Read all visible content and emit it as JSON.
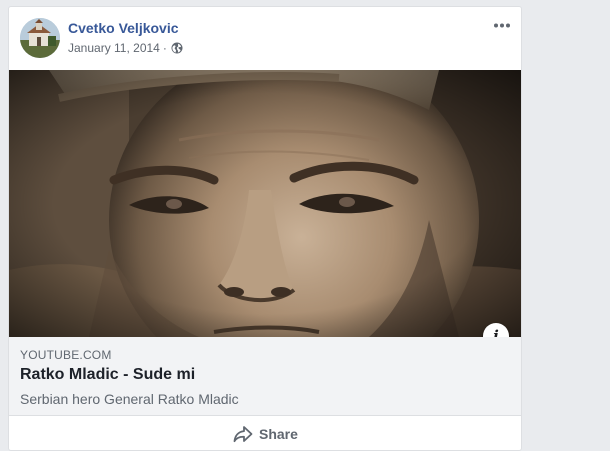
{
  "post": {
    "author": "Cvetko Veljkovic",
    "date": "January 11, 2014",
    "separator": "·",
    "privacy_icon": "globe-icon",
    "more_icon": "more-options-icon"
  },
  "link_preview": {
    "domain": "YOUTUBE.COM",
    "title": "Ratko Mladic - Sude mi",
    "description": "Serbian hero General Ratko Mladic",
    "info_label": "i"
  },
  "actions": {
    "share_label": "Share",
    "share_icon": "share-icon"
  },
  "colors": {
    "author_link": "#385898",
    "meta_text": "#606770",
    "preview_background": "#f2f3f5",
    "page_background": "#e9ebee"
  }
}
